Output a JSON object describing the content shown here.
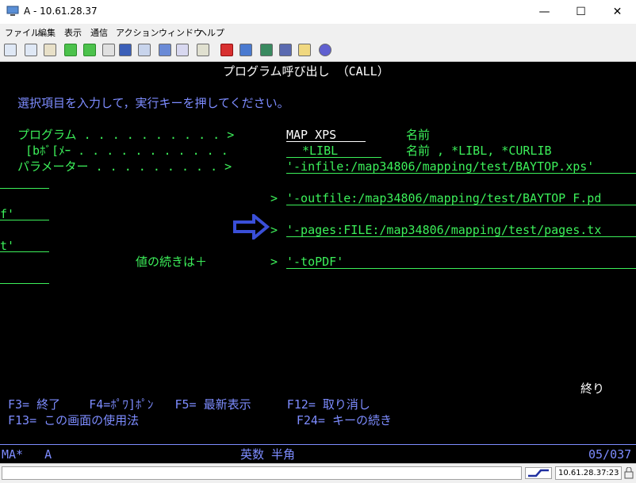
{
  "window": {
    "title": "A - 10.61.28.37",
    "minimize": "—",
    "maximize": "☐",
    "close": "✕"
  },
  "menu": [
    "ファイル",
    "編集",
    "表示",
    "通信",
    "アクション",
    "ウィンドウ",
    "ヘルプ"
  ],
  "toolbar": {
    "icons": [
      "copy-icon",
      "paste-icon",
      "clipboard-icon",
      "send-icon",
      "receive-icon",
      "print-icon",
      "screen-icon",
      "macro-icon",
      "keyboard-icon",
      "grid-icon",
      "settings-icon",
      "record-icon",
      "play-icon",
      "stop-icon",
      "pause-icon",
      "notes-icon",
      "help-icon"
    ]
  },
  "screen": {
    "header": "プログラム呼び出し （CALL）",
    "instruction": "選択項目を入力して，実行キーを押してください。",
    "program_label": "プログラム . . . . . . . . . . >",
    "program_value": "MAP_XPS",
    "program_desc": "名前",
    "library_label": "[bﾎﾞ[ﾒｰ . . . . . . . . . . .",
    "library_value": "*LIBL",
    "library_desc": "名前 , *LIBL, *CURLIB",
    "param_label": "パラメーター . . . . . . . . . >",
    "param1": "'-infile:/map34806/mapping/test/BAYTOP.xps'",
    "param2_arrow": ">",
    "param2": "'-outfile:/map34806/mapping/test/BAYTOP_F.pd",
    "param2_cont": "f'",
    "param3_arrow": ">",
    "param3": "'-pages:FILE:/map34806/mapping/test/pages.tx",
    "param3_cont": "t'",
    "continue_label": "値の続きは＋",
    "param4_arrow": ">",
    "param4": "'-toPDF'",
    "end_marker": "終り",
    "fkeys_row1": "F3= 終了    F4=ﾎﾟﾜ]ﾎﾟﾝ   F5= 最新表示     F12= 取り消し",
    "fkeys_row2": "F13= この画面の使用法                      F24= キーの続き",
    "status_left": "MA*   A",
    "status_mid": "英数 半角",
    "status_right": "05/037"
  },
  "colors": {
    "screen_bg": "#000000",
    "green": "#3cf05a",
    "blue": "#7d8cff",
    "white": "#ffffff",
    "arrow": "#3a4fd8"
  },
  "statusbar": {
    "address": "10.61.28.37:23"
  }
}
